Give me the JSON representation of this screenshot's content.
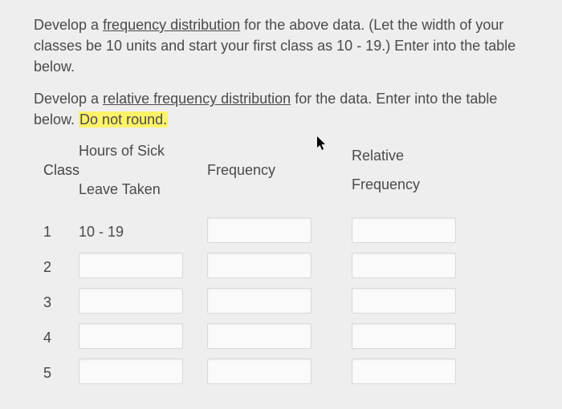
{
  "instructions": {
    "p1_a": "Develop a ",
    "p1_b": "frequency distribution",
    "p1_c": " for the above data. (Let the width of your classes be 10 units and start your first class as 10 - 19.) Enter into the table below.",
    "p2_a": "Develop a ",
    "p2_b": "relative frequency distribution",
    "p2_c": " for the data. Enter into the table below. ",
    "p2_d": "Do not round."
  },
  "headers": {
    "class": "Class",
    "hours1": "Hours of Sick",
    "hours2": "Leave Taken",
    "freq": "Frequency",
    "rel1": "Relative",
    "rel2": "Frequency"
  },
  "rows": [
    {
      "n": "1",
      "hours": "10 - 19",
      "freq": "",
      "rel": ""
    },
    {
      "n": "2",
      "hours": "",
      "freq": "",
      "rel": ""
    },
    {
      "n": "3",
      "hours": "",
      "freq": "",
      "rel": ""
    },
    {
      "n": "4",
      "hours": "",
      "freq": "",
      "rel": ""
    },
    {
      "n": "5",
      "hours": "",
      "freq": "",
      "rel": ""
    }
  ]
}
